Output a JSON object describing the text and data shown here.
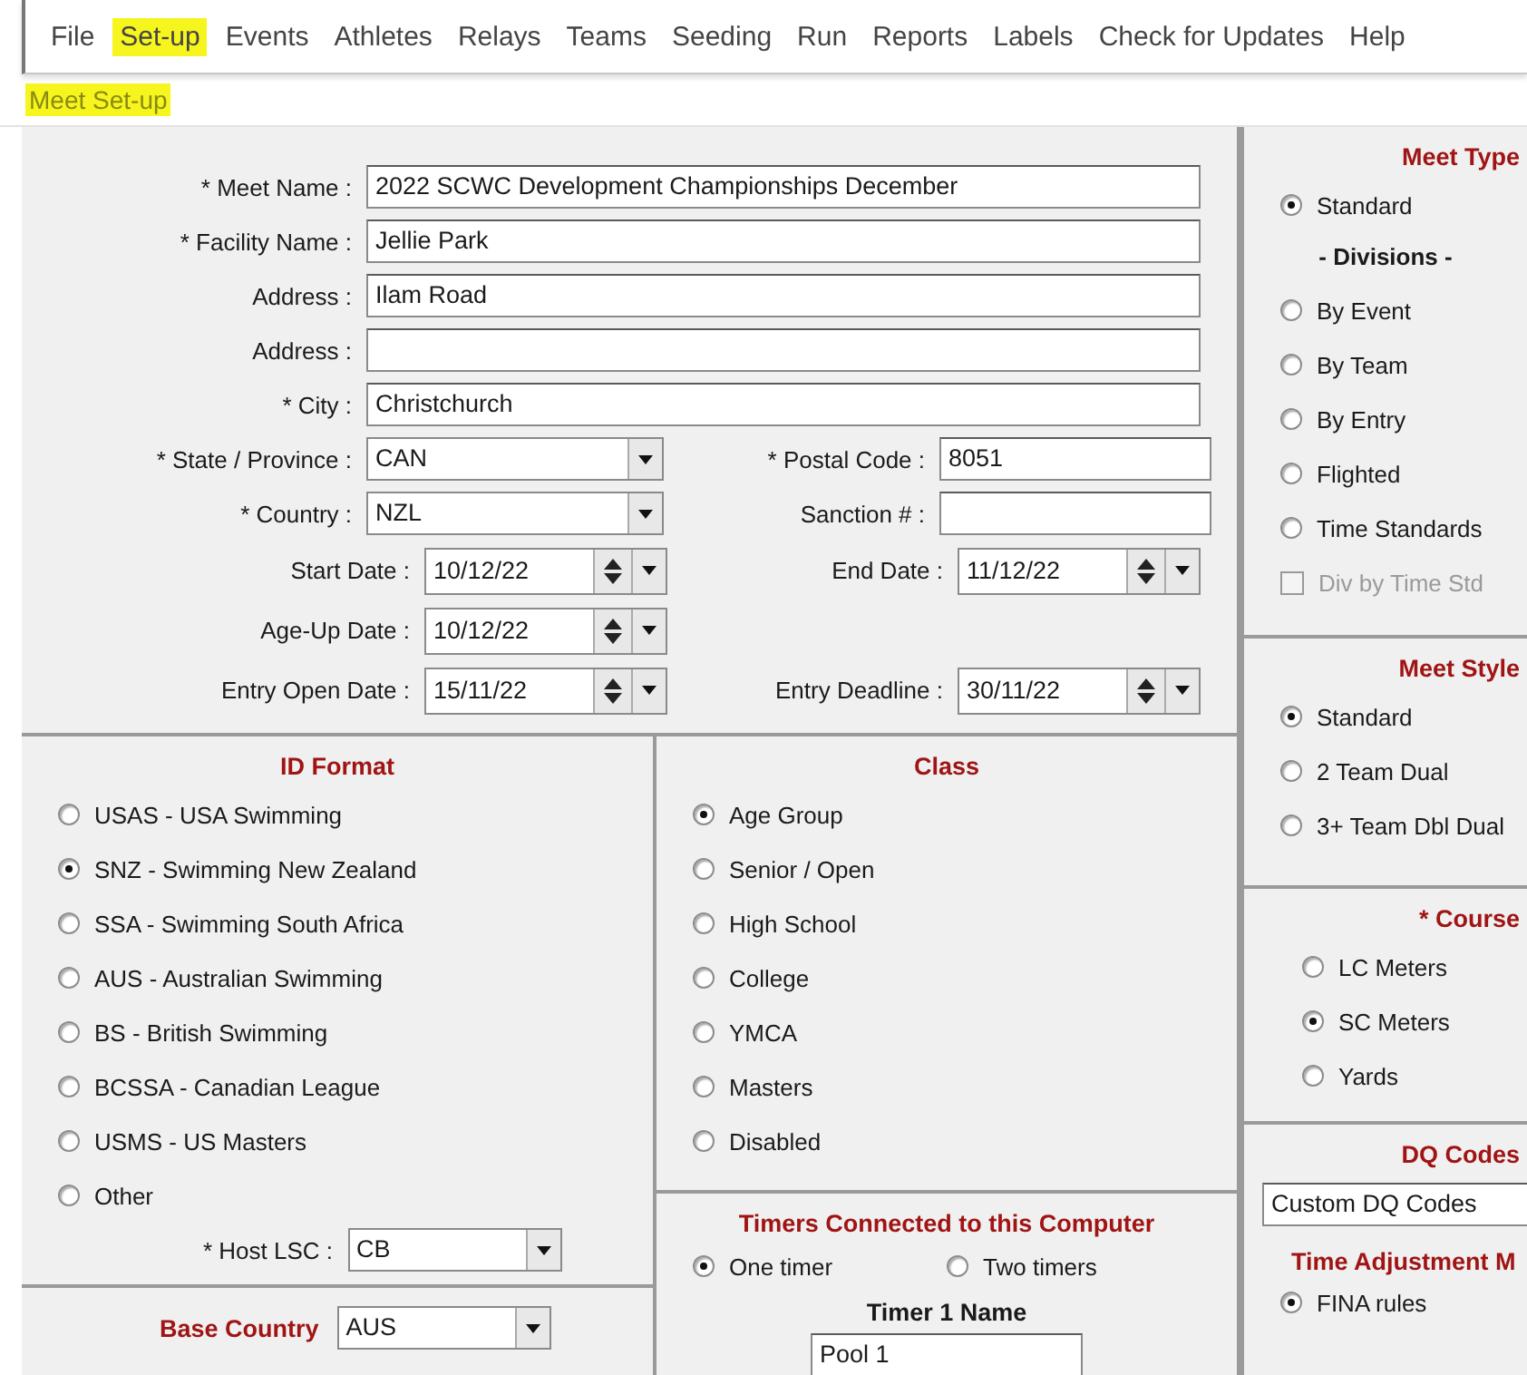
{
  "menu": {
    "items": [
      {
        "label": "File",
        "highlighted": false
      },
      {
        "label": "Set-up",
        "highlighted": true
      },
      {
        "label": "Events",
        "highlighted": false
      },
      {
        "label": "Athletes",
        "highlighted": false
      },
      {
        "label": "Relays",
        "highlighted": false
      },
      {
        "label": "Teams",
        "highlighted": false
      },
      {
        "label": "Seeding",
        "highlighted": false
      },
      {
        "label": "Run",
        "highlighted": false
      },
      {
        "label": "Reports",
        "highlighted": false
      },
      {
        "label": "Labels",
        "highlighted": false
      },
      {
        "label": "Check for Updates",
        "highlighted": false
      },
      {
        "label": "Help",
        "highlighted": false
      }
    ]
  },
  "submenu": {
    "label": "Meet Set-up",
    "highlighted": true
  },
  "meet_form": {
    "rows": [
      {
        "items": [
          {
            "kind": "text",
            "label": "* Meet Name :",
            "value": "2022 SCWC Development Championships December"
          }
        ]
      },
      {
        "items": [
          {
            "kind": "text",
            "label": "* Facility Name :",
            "value": "Jellie Park"
          }
        ]
      },
      {
        "items": [
          {
            "kind": "text",
            "label": "Address :",
            "value": "Ilam Road"
          }
        ]
      },
      {
        "items": [
          {
            "kind": "text",
            "label": "Address :"
          }
        ]
      },
      {
        "items": [
          {
            "kind": "text",
            "label": "* City :",
            "value": "Christchurch"
          }
        ]
      },
      {
        "items": [
          {
            "kind": "select",
            "label": "* State / Province :",
            "value": "CAN"
          },
          {
            "kind": "text",
            "label": "* Postal Code :",
            "value": "8051"
          }
        ]
      },
      {
        "items": [
          {
            "kind": "select",
            "label": "* Country :",
            "value": "NZL"
          },
          {
            "kind": "text",
            "label": "Sanction # :"
          }
        ]
      },
      {
        "items": [
          {
            "kind": "date",
            "label": "Start Date :",
            "value": "10/12/22"
          },
          {
            "kind": "date",
            "label": "End Date :",
            "value": "11/12/22"
          }
        ]
      },
      {
        "items": [
          {
            "kind": "date",
            "label": "Age-Up Date :",
            "value": "10/12/22"
          }
        ]
      },
      {
        "items": [
          {
            "kind": "date",
            "label": "Entry Open Date :",
            "value": "15/11/22"
          },
          {
            "kind": "date",
            "label": "Entry Deadline :",
            "value": "30/11/22"
          }
        ]
      }
    ]
  },
  "id_format": {
    "title": "ID Format",
    "options": [
      {
        "label": "USAS - USA Swimming",
        "selected": false
      },
      {
        "label": "SNZ - Swimming New Zealand",
        "selected": true
      },
      {
        "label": "SSA - Swimming South Africa",
        "selected": false
      },
      {
        "label": "AUS - Australian Swimming",
        "selected": false
      },
      {
        "label": "BS - British Swimming",
        "selected": false
      },
      {
        "label": "BCSSA - Canadian League",
        "selected": false
      },
      {
        "label": "USMS - US Masters",
        "selected": false
      },
      {
        "label": "Other",
        "selected": false
      }
    ],
    "host_lsc": {
      "label": "* Host LSC :",
      "value": "CB"
    }
  },
  "base_country": {
    "label": "Base Country",
    "value": "AUS"
  },
  "class": {
    "title": "Class",
    "options": [
      {
        "label": "Age Group",
        "selected": true
      },
      {
        "label": "Senior / Open",
        "selected": false
      },
      {
        "label": "High School",
        "selected": false
      },
      {
        "label": "College",
        "selected": false
      },
      {
        "label": "YMCA",
        "selected": false
      },
      {
        "label": "Masters",
        "selected": false
      },
      {
        "label": "Disabled",
        "selected": false
      }
    ]
  },
  "timers": {
    "title": "Timers Connected to this Computer",
    "options": [
      {
        "label": "One timer",
        "selected": true
      },
      {
        "label": "Two timers",
        "selected": false
      }
    ],
    "timer_name_label": "Timer 1 Name",
    "timer_name_value": "Pool 1"
  },
  "meet_type": {
    "title": "Meet Type",
    "items": [
      {
        "kind": "radio",
        "label": "Standard",
        "selected": true
      },
      {
        "kind": "heading",
        "label": "- Divisions -"
      },
      {
        "kind": "radio",
        "label": "By Event",
        "selected": false
      },
      {
        "kind": "radio",
        "label": "By Team",
        "selected": false
      },
      {
        "kind": "radio",
        "label": "By Entry",
        "selected": false
      },
      {
        "kind": "radio",
        "label": "Flighted",
        "selected": false
      },
      {
        "kind": "radio",
        "label": "Time Standards",
        "selected": false
      },
      {
        "kind": "checkbox",
        "label": "Div by Time Std",
        "checked": false,
        "disabled": true
      }
    ]
  },
  "meet_style": {
    "title": "Meet Style",
    "options": [
      {
        "label": "Standard",
        "selected": true
      },
      {
        "label": "2 Team Dual",
        "selected": false
      },
      {
        "label": "3+ Team Dbl Dual",
        "selected": false
      }
    ]
  },
  "course": {
    "title": "* Course",
    "options": [
      {
        "label": "LC Meters",
        "selected": false
      },
      {
        "label": "SC Meters",
        "selected": true
      },
      {
        "label": "Yards",
        "selected": false
      }
    ]
  },
  "dq_codes": {
    "title": "DQ Codes",
    "value": "Custom DQ Codes"
  },
  "time_adjustment": {
    "title": "Time Adjustment M",
    "options": [
      {
        "label": "FINA rules",
        "selected": true
      }
    ]
  }
}
